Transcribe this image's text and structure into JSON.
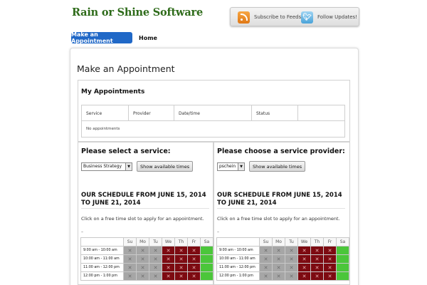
{
  "header": {
    "logo_text": "Rain or Shine Software",
    "subscribe_label": "Subscribe to Feeds",
    "follow_label": "Follow Updates!",
    "rss_icon": "rss-icon",
    "twitter_icon": "bird-icon"
  },
  "nav": {
    "appointment_label": "Make an Appointment",
    "home_label": "Home"
  },
  "page": {
    "title": "Make an Appointment"
  },
  "appointments": {
    "title": "My Appointments",
    "columns": [
      "Service",
      "Provider",
      "Date/time",
      "Status",
      ""
    ],
    "empty_text": "No appointments"
  },
  "service": {
    "title": "Please select a service:",
    "selected": "Business Strategy",
    "button": "Show available times"
  },
  "provider": {
    "title": "Please choose a service provider:",
    "selected": "pschein",
    "button": "Show available times"
  },
  "schedule": {
    "title": "OUR SCHEDULE FROM JUNE 15, 2014 TO JUNE 21, 2014",
    "note": "Click on a free time slot to apply for an appointment.",
    "dash": "–",
    "days": [
      "Su",
      "Mo",
      "Tu",
      "We",
      "Th",
      "Fr",
      "Sa"
    ],
    "times": [
      "9:00 am - 10:00 am",
      "10:00 am - 11:00 am",
      "11:00 am - 12:00 pm",
      "12:00 pm - 1:00 pm"
    ],
    "pattern": [
      "gray",
      "gray",
      "gray",
      "red",
      "red",
      "red",
      "green"
    ],
    "colors": {
      "gray": "#a6a6a6",
      "red": "#7d0a11",
      "green": "#4bc63a"
    }
  }
}
